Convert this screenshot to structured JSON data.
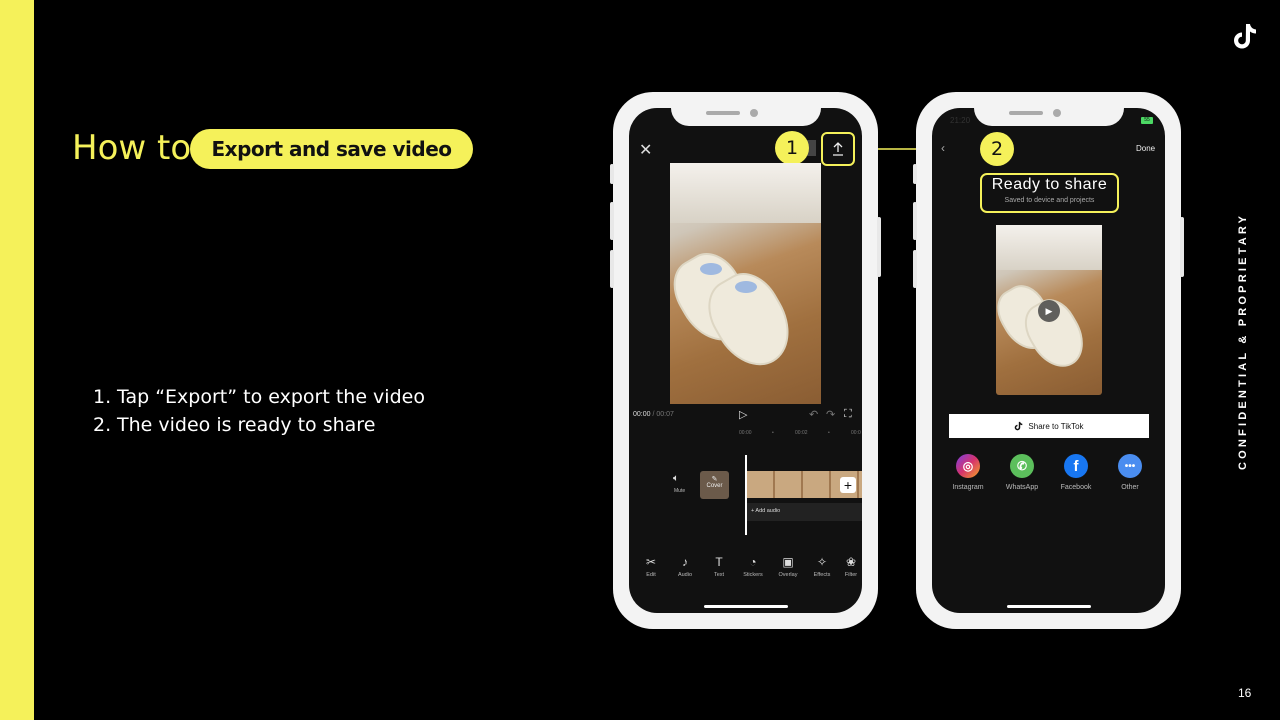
{
  "slide": {
    "heading": "How to",
    "pill_label": "Export and save video",
    "steps": [
      {
        "num": "1.",
        "text": "Tap “Export” to export the video"
      },
      {
        "num": "2.",
        "text": "The video is ready to share"
      }
    ],
    "side_label": "CONFIDENTIAL & PROPRIETARY",
    "page_number": "16",
    "accent_color": "#f5f15a"
  },
  "phone1": {
    "badge": "1",
    "time_current": "00:00",
    "time_sep": "/",
    "time_total": "00:07",
    "ruler": [
      "00:00",
      "•",
      "00:02",
      "•",
      "00:0"
    ],
    "mute_label": "Mute",
    "cover_label": "Cover",
    "add_audio_label": "+ Add audio",
    "toolbar": [
      {
        "icon": "scissors-icon",
        "glyph": "✂",
        "label": "Edit"
      },
      {
        "icon": "music-note-icon",
        "glyph": "♪",
        "label": "Audio"
      },
      {
        "icon": "text-icon",
        "glyph": "T",
        "label": "Text"
      },
      {
        "icon": "sticker-icon",
        "glyph": "◔",
        "label": "Stickers"
      },
      {
        "icon": "overlay-icon",
        "glyph": "▣",
        "label": "Overlay"
      },
      {
        "icon": "effects-icon",
        "glyph": "✧",
        "label": "Effects"
      },
      {
        "icon": "filters-icon",
        "glyph": "❀",
        "label": "Filter"
      }
    ]
  },
  "phone2": {
    "badge": "2",
    "status_time": "21:20",
    "battery": "55",
    "done_label": "Done",
    "title": "Ready to share",
    "subtitle": "Saved to device and projects",
    "share_tiktok_label": "Share to TikTok",
    "share_targets": [
      {
        "icon": "instagram-icon",
        "label": "Instagram",
        "color": "#d6336c"
      },
      {
        "icon": "whatsapp-icon",
        "label": "WhatsApp",
        "color": "#5cbf5c"
      },
      {
        "icon": "facebook-icon",
        "label": "Facebook",
        "color": "#1877f2"
      },
      {
        "icon": "more-icon",
        "label": "Other",
        "color": "#4a8df0"
      }
    ]
  }
}
